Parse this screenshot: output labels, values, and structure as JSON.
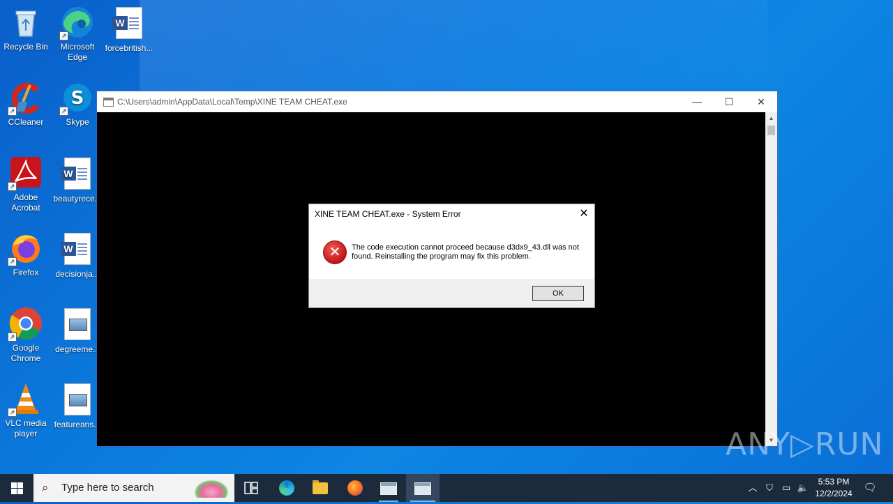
{
  "desktop": {
    "icons": [
      {
        "label": "Recycle Bin"
      },
      {
        "label": "Microsoft Edge",
        "line2": "Edge",
        "line1": "Microsoft"
      },
      {
        "label": "forcebritish..."
      },
      {
        "label": "CCleaner"
      },
      {
        "label": "Skype"
      },
      {
        "label": "Adobe",
        "line2": "Acrobat"
      },
      {
        "label": "beautyrece..."
      },
      {
        "label": "Firefox"
      },
      {
        "label": "decisionja..."
      },
      {
        "label": "Google",
        "line2": "Chrome"
      },
      {
        "label": "degreeme..."
      },
      {
        "label": "VLC media",
        "line2": "player"
      },
      {
        "label": "featureans..."
      }
    ]
  },
  "console": {
    "title": "C:\\Users\\admin\\AppData\\Local\\Temp\\XINE TEAM CHEAT.exe",
    "minimize": "—",
    "maximize": "☐",
    "close": "✕"
  },
  "dialog": {
    "title": "XINE TEAM CHEAT.exe - System Error",
    "close": "✕",
    "message": "The code execution cannot proceed because d3dx9_43.dll was not found. Reinstalling the program may fix this problem.",
    "ok_label": "OK"
  },
  "watermark": "ANY▷RUN",
  "taskbar": {
    "search_placeholder": "Type here to search",
    "time": "5:53 PM",
    "date": "12/2/2024",
    "accent": "#76b9ed"
  }
}
